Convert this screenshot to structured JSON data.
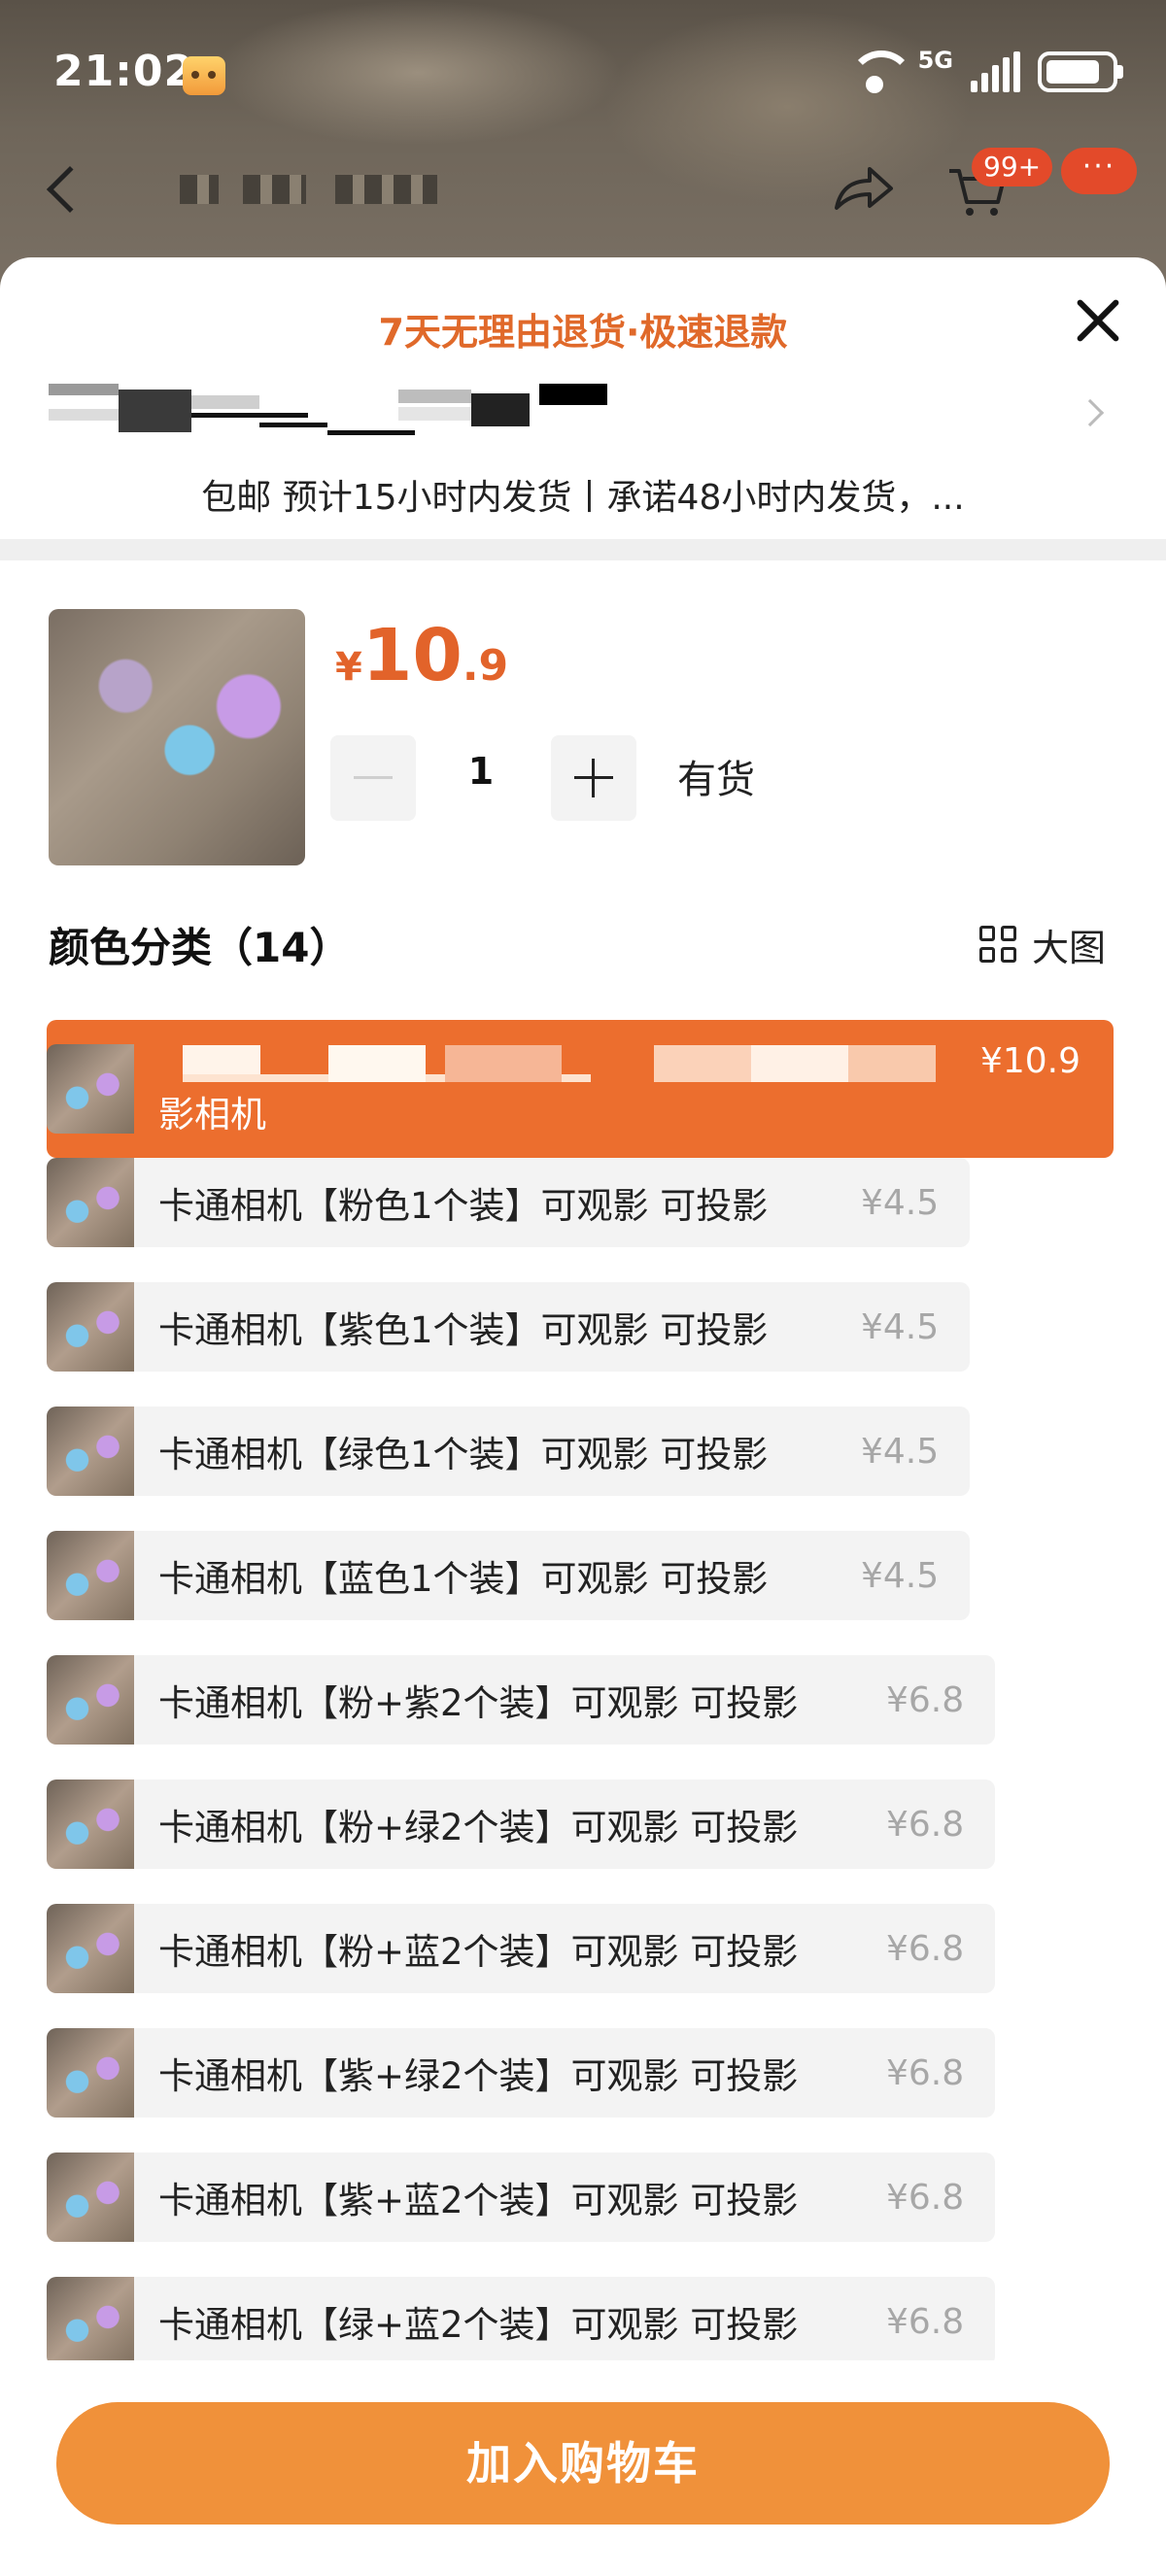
{
  "status_bar": {
    "time": "21:02",
    "network": "5G"
  },
  "nav": {
    "cart_badge": "99+",
    "more_label": "···"
  },
  "sheet": {
    "promo": "7天无理由退货·极速退款",
    "shipping": "包邮 预计15小时内发货丨承诺48小时内发货，...",
    "product": {
      "price_currency": "¥",
      "price_int": "10",
      "price_dec": ".9",
      "quantity": "1",
      "stock": "有货"
    },
    "section": {
      "title": "颜色分类（14）",
      "big_view_label": "大图"
    },
    "options": [
      {
        "label": "影相机",
        "price": "¥10.9",
        "selected": true
      },
      {
        "label": "卡通相机【粉色1个装】可观影 可投影",
        "price": "¥4.5"
      },
      {
        "label": "卡通相机【紫色1个装】可观影 可投影",
        "price": "¥4.5"
      },
      {
        "label": "卡通相机【绿色1个装】可观影 可投影",
        "price": "¥4.5"
      },
      {
        "label": "卡通相机【蓝色1个装】可观影 可投影",
        "price": "¥4.5"
      },
      {
        "label": "卡通相机【粉+紫2个装】可观影 可投影",
        "price": "¥6.8"
      },
      {
        "label": "卡通相机【粉+绿2个装】可观影 可投影",
        "price": "¥6.8"
      },
      {
        "label": "卡通相机【粉+蓝2个装】可观影 可投影",
        "price": "¥6.8"
      },
      {
        "label": "卡通相机【紫+绿2个装】可观影 可投影",
        "price": "¥6.8"
      },
      {
        "label": "卡通相机【紫+蓝2个装】可观影 可投影",
        "price": "¥6.8"
      },
      {
        "label": "卡通相机【绿+蓝2个装】可观影 可投影",
        "price": "¥6.8"
      }
    ],
    "add_to_cart": "加入购物车"
  },
  "colors": {
    "accent_orange": "#ec6e2e",
    "price_orange": "#e2632a",
    "button_orange": "#f0913a",
    "promo_orange": "#e0692a"
  }
}
